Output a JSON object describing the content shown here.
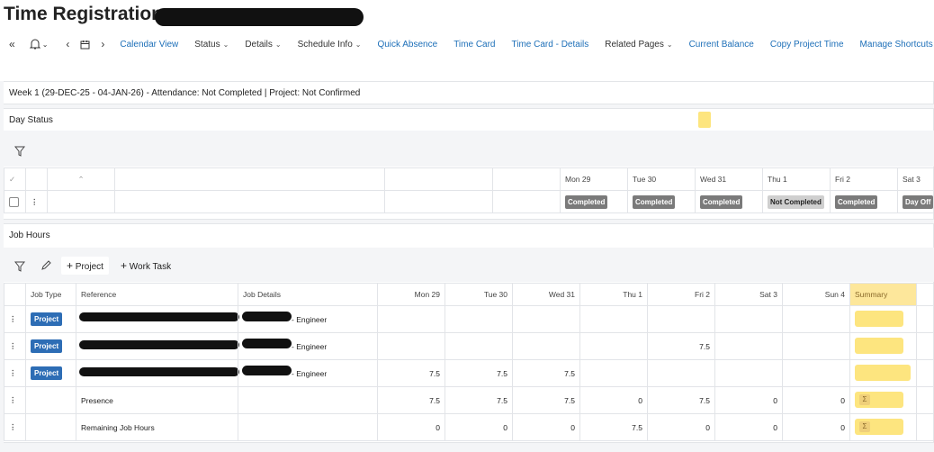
{
  "header": {
    "title": "Time Registration"
  },
  "toolbar": {
    "items": [
      "Calendar View",
      "Status",
      "Details",
      "Schedule Info",
      "Quick Absence",
      "Time Card",
      "Time Card - Details",
      "Related Pages",
      "Current Balance",
      "Copy Project Time",
      "Manage Shortcuts"
    ]
  },
  "week": {
    "summary": "Week 1 (29-DEC-25 - 04-JAN-26) - Attendance: Not Completed | Project: Not Confirmed"
  },
  "day_status": {
    "title": "Day Status",
    "days": [
      "Mon 29",
      "Tue 30",
      "Wed 31",
      "Thu 1",
      "Fri 2",
      "Sat 3"
    ],
    "statuses": [
      "Completed",
      "Completed",
      "Completed",
      "Not Completed",
      "Completed",
      "Day Off"
    ]
  },
  "job_hours": {
    "title": "Job Hours",
    "add_project": "Project",
    "add_work_task": "Work Task",
    "columns": [
      "Job Type",
      "Reference",
      "Job Details",
      "Mon 29",
      "Tue 30",
      "Wed 31",
      "Thu 1",
      "Fri 2",
      "Sat 3",
      "Sun 4",
      "Summary"
    ],
    "rows": [
      {
        "type": "Project",
        "reference": "",
        "details": "- Engineer",
        "values": [
          "",
          "",
          "",
          "",
          "",
          "",
          ""
        ]
      },
      {
        "type": "Project",
        "reference": "",
        "details": "- Engineer",
        "values": [
          "",
          "",
          "",
          "",
          "7.5",
          "",
          ""
        ]
      },
      {
        "type": "Project",
        "reference": "",
        "details": "- Engineer",
        "values": [
          "7.5",
          "7.5",
          "7.5",
          "",
          "",
          "",
          ""
        ]
      },
      {
        "type": "",
        "reference": "Presence",
        "details": "",
        "values": [
          "7.5",
          "7.5",
          "7.5",
          "0",
          "7.5",
          "0",
          "0"
        ]
      },
      {
        "type": "",
        "reference": "Remaining Job Hours",
        "details": "",
        "values": [
          "0",
          "0",
          "0",
          "7.5",
          "0",
          "0",
          "0"
        ]
      }
    ],
    "sigma": "Σ"
  }
}
